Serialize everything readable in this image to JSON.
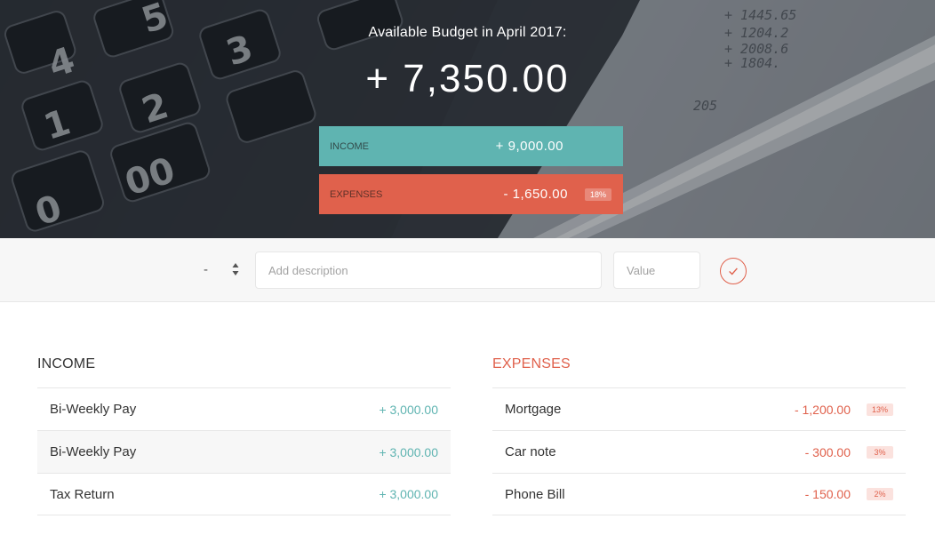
{
  "header": {
    "title": "Available Budget in April 2017:",
    "budget": "+ 7,350.00",
    "income": {
      "label": "INCOME",
      "value": "+ 9,000.00"
    },
    "expenses": {
      "label": "EXPENSES",
      "value": "- 1,650.00",
      "percentage": "18%"
    }
  },
  "add_bar": {
    "type_value": "-",
    "description_placeholder": "Add description",
    "value_placeholder": "Value"
  },
  "income": {
    "title": "INCOME",
    "items": [
      {
        "description": "Bi-Weekly Pay",
        "value": "+ 3,000.00"
      },
      {
        "description": "Bi-Weekly Pay",
        "value": "+ 3,000.00"
      },
      {
        "description": "Tax Return",
        "value": "+ 3,000.00"
      }
    ]
  },
  "expenses": {
    "title": "EXPENSES",
    "items": [
      {
        "description": "Mortgage",
        "value": "- 1,200.00",
        "percentage": "13%"
      },
      {
        "description": "Car note",
        "value": "- 300.00",
        "percentage": "3%"
      },
      {
        "description": "Phone Bill",
        "value": "- 150.00",
        "percentage": "2%"
      }
    ]
  },
  "colors": {
    "income": "#5fb4b1",
    "expenses": "#e0614c"
  }
}
